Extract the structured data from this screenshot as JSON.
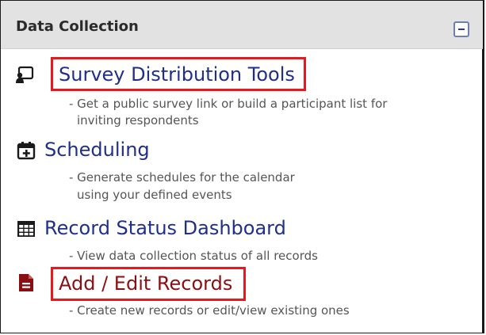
{
  "panel": {
    "title": "Data Collection",
    "collapse_icon": "minus-square-icon"
  },
  "items": [
    {
      "icon": "survey-distribution-icon",
      "label": "Survey Distribution Tools",
      "description_lines": [
        "- Get a public survey link or build a participant list for",
        "inviting respondents"
      ],
      "highlighted": true
    },
    {
      "icon": "calendar-plus-icon",
      "label": "Scheduling",
      "description_lines": [
        "- Generate schedules for the calendar",
        "using your defined events"
      ],
      "highlighted": false
    },
    {
      "icon": "table-grid-icon",
      "label": "Record Status Dashboard",
      "description_lines": [
        "- View data collection status of all records"
      ],
      "highlighted": false
    },
    {
      "icon": "file-document-icon",
      "label": "Add / Edit Records",
      "description_lines": [
        "- Create new records or edit/view existing ones"
      ],
      "highlighted": true
    }
  ],
  "colors": {
    "link": "#1f2f8a",
    "link_active": "#8a0f12",
    "highlight_border": "#e5191e",
    "header_bg": "#e2e2e2"
  }
}
